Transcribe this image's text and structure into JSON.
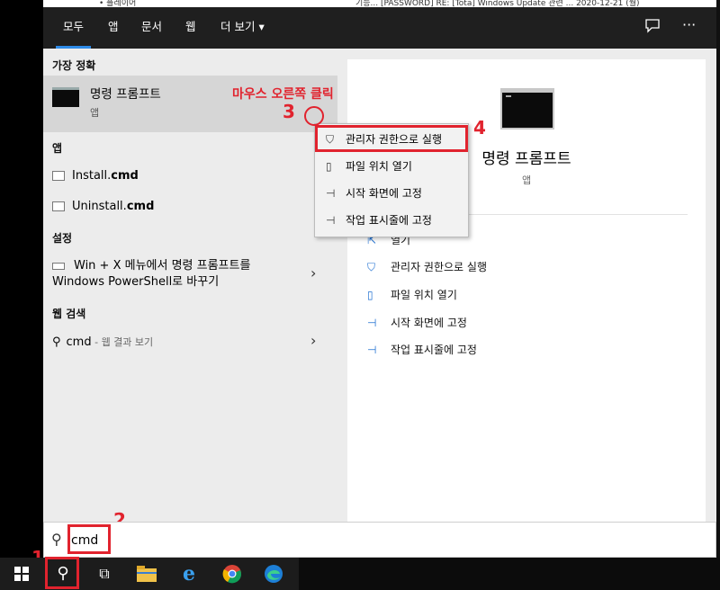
{
  "background": {
    "top_text": "• 플레이어",
    "top_right_text": "기능... [PASSWORD] RE: [Tota] Windows Update 관련 ... 2020-12-21 (월)"
  },
  "tabs": [
    {
      "label": "모두",
      "active": true
    },
    {
      "label": "앱"
    },
    {
      "label": "문서"
    },
    {
      "label": "웹"
    },
    {
      "label": "더 보기 ▾"
    }
  ],
  "topbar_icons": [
    "feedback-icon",
    "more-icon"
  ],
  "more_label": "···",
  "left": {
    "best_match_title": "가장 정확",
    "best_match": {
      "name": "명령 프롬프트",
      "sub": "앱"
    },
    "apps_title": "앱",
    "apps": [
      {
        "name": "Install.",
        "bold": "cmd"
      },
      {
        "name": "Uninstall.",
        "bold": "cmd"
      }
    ],
    "settings_title": "설정",
    "settings_line1": "Win + X 메뉴에서 명령 프롬프트를",
    "settings_line2": "Windows PowerShell로 바꾸기",
    "web_title": "웹 검색",
    "web_query": "cmd",
    "web_suffix": " - 웹 결과 보기"
  },
  "right": {
    "title": "명령 프롬프트",
    "sub": "앱",
    "actions": [
      "열기",
      "관리자 권한으로 실행",
      "파일 위치 열기",
      "시작 화면에 고정",
      "작업 표시줄에 고정"
    ]
  },
  "context_menu": {
    "items": [
      "관리자 권한으로 실행",
      "파일 위치 열기",
      "시작 화면에 고정",
      "작업 표시줄에 고정"
    ]
  },
  "annotations": {
    "step1": "1",
    "step2": "2",
    "step3": "3",
    "step4": "4",
    "right_click_label": "마우스 오른쪽 클릭"
  },
  "search": {
    "value": "cmd",
    "placeholder": ""
  },
  "taskbar": [
    "windows-start-icon",
    "search-icon",
    "task-view-icon",
    "file-explorer-icon",
    "internet-explorer-icon",
    "chrome-icon",
    "edge-icon"
  ],
  "colors": {
    "annotation": "#e1232e",
    "accent": "#2d8ae6",
    "action_icon": "#1c6ed1"
  }
}
